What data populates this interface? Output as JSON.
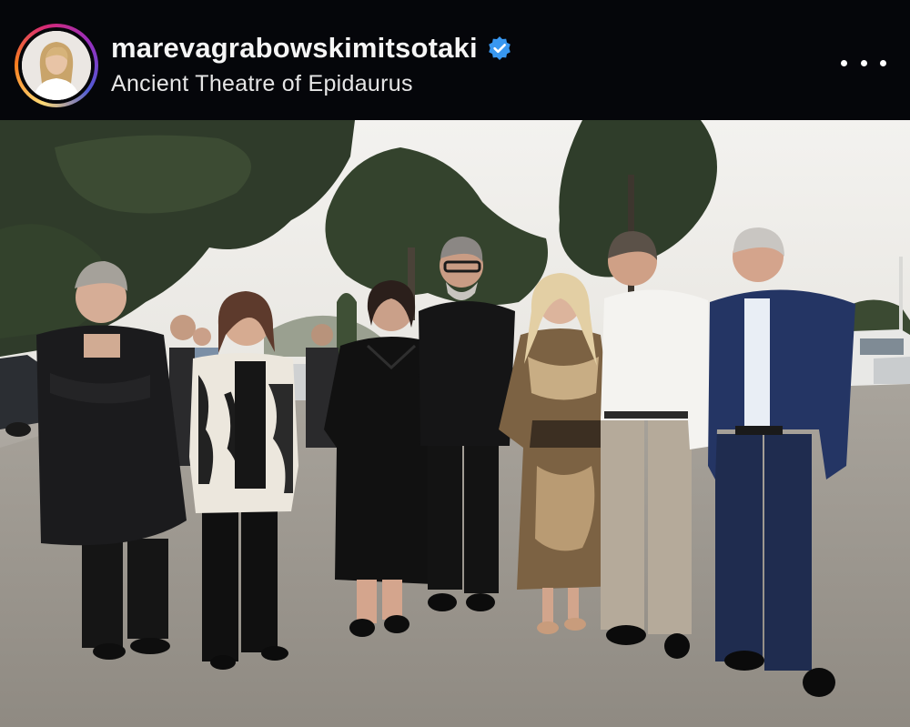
{
  "post": {
    "username": "marevagrabowskimitsotaki",
    "location": "Ancient Theatre of Epidaurus",
    "verified": true
  },
  "icons": {
    "verified": "verified-badge-icon",
    "more": "more-options-icon"
  },
  "colors": {
    "header_bg": "#05060a",
    "verified_blue": "#3897f0",
    "text": "#ffffff"
  }
}
